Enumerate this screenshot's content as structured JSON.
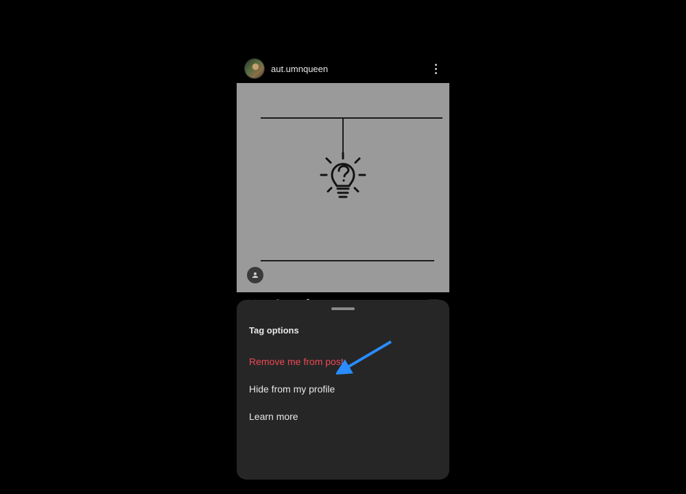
{
  "colors": {
    "accent_red": "#ed4956",
    "sheet_bg": "#262626"
  },
  "post": {
    "username": "aut.umnqueen"
  },
  "sheet": {
    "title": "Tag options",
    "items": {
      "remove": "Remove me from post",
      "hide": "Hide from my profile",
      "learn": "Learn more"
    }
  }
}
